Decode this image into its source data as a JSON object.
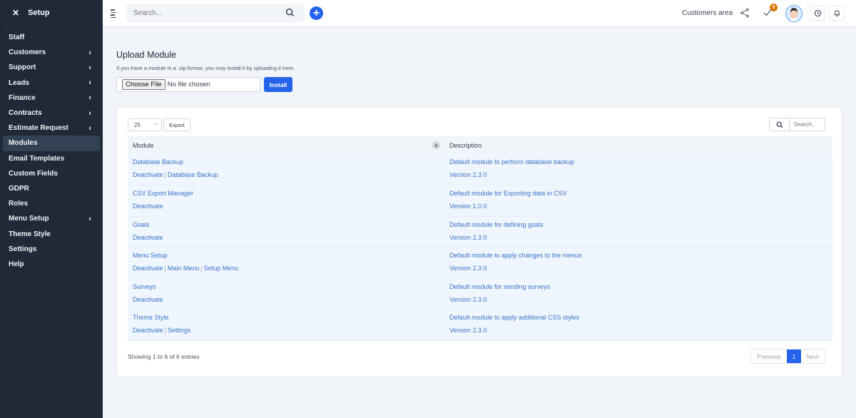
{
  "sidebar": {
    "close_icon": "✕",
    "title": "Setup",
    "items": [
      {
        "label": "Staff",
        "has_chevron": false
      },
      {
        "label": "Customers",
        "has_chevron": true
      },
      {
        "label": "Support",
        "has_chevron": true
      },
      {
        "label": "Leads",
        "has_chevron": true
      },
      {
        "label": "Finance",
        "has_chevron": true
      },
      {
        "label": "Contracts",
        "has_chevron": true
      },
      {
        "label": "Estimate Request",
        "has_chevron": true
      },
      {
        "label": "Modules",
        "has_chevron": false,
        "active": true
      },
      {
        "label": "Email Templates",
        "has_chevron": false
      },
      {
        "label": "Custom Fields",
        "has_chevron": false
      },
      {
        "label": "GDPR",
        "has_chevron": false
      },
      {
        "label": "Roles",
        "has_chevron": false
      },
      {
        "label": "Menu Setup",
        "has_chevron": true
      },
      {
        "label": "Theme Style",
        "has_chevron": false
      },
      {
        "label": "Settings",
        "has_chevron": false
      },
      {
        "label": "Help",
        "has_chevron": false
      }
    ]
  },
  "topbar": {
    "search_placeholder": "Search...",
    "plus_label": "+",
    "customers_area": "Customers area",
    "todo_badge": "3"
  },
  "upload": {
    "title": "Upload Module",
    "hint": "If you have a module in a .zip format, you may install it by uploading it here.",
    "choose_file": "Choose File",
    "no_file": "No file chosen",
    "install": "Install"
  },
  "table": {
    "page_length": "25",
    "export": "Export",
    "search_placeholder": "Search..",
    "headers": {
      "module": "Module",
      "description": "Description"
    },
    "rows": [
      {
        "name": "Database Backup",
        "actions": [
          "Deactivate",
          "Database Backup"
        ],
        "description": "Default module to perform database backup",
        "version": "Version 2.3.0"
      },
      {
        "name": "CSV Export Manager",
        "actions": [
          "Deactivate"
        ],
        "description": "Default module for Exporting data in CSV",
        "version": "Version 1.0.0"
      },
      {
        "name": "Goals",
        "actions": [
          "Deactivate"
        ],
        "description": "Default module for defining goals",
        "version": "Version 2.3.0"
      },
      {
        "name": "Menu Setup",
        "actions": [
          "Deactivate",
          "Main Menu",
          "Setup Menu"
        ],
        "description": "Default module to apply changes to the menus",
        "version": "Version 2.3.0"
      },
      {
        "name": "Surveys",
        "actions": [
          "Deactivate"
        ],
        "description": "Default module for sending surveys",
        "version": "Version 2.3.0"
      },
      {
        "name": "Theme Style",
        "actions": [
          "Deactivate",
          "Settings"
        ],
        "description": "Default module to apply additional CSS styles",
        "version": "Version 2.3.0"
      }
    ],
    "showing": "Showing 1 to 6 of 6 entries",
    "pagination": {
      "previous": "Previous",
      "current": "1",
      "next": "Next"
    }
  }
}
